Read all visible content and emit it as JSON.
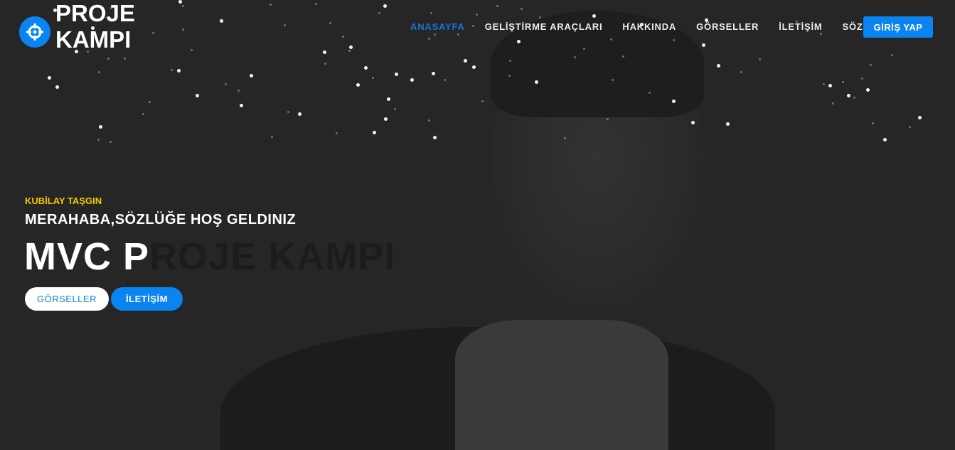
{
  "brand": {
    "line1": "PROJE",
    "line2": "KAMPI",
    "icon": "crosshair-icon"
  },
  "nav": {
    "items": [
      {
        "label": "ANASAYFA",
        "active": true
      },
      {
        "label": "GELİŞTİRME ARAÇLARI"
      },
      {
        "label": "HAKKINDA"
      },
      {
        "label": "GÖRSELLER"
      },
      {
        "label": "İLETİŞİM"
      },
      {
        "label": "SÖZLÜK"
      }
    ],
    "login": "GİRİŞ YAP"
  },
  "hero": {
    "author": "KUBİLAY TAŞGIN",
    "welcome": "MERAHABA,SÖZLÜĞE HOŞ GELDINIZ",
    "title_typed": "MVC P",
    "title_rest": "ROJE KAMPI",
    "buttons": [
      "GÖRSELLER",
      "İLETİŞİM"
    ]
  },
  "colors": {
    "accent": "#0a84f0",
    "highlight": "#f5c800",
    "background": "#262626"
  }
}
